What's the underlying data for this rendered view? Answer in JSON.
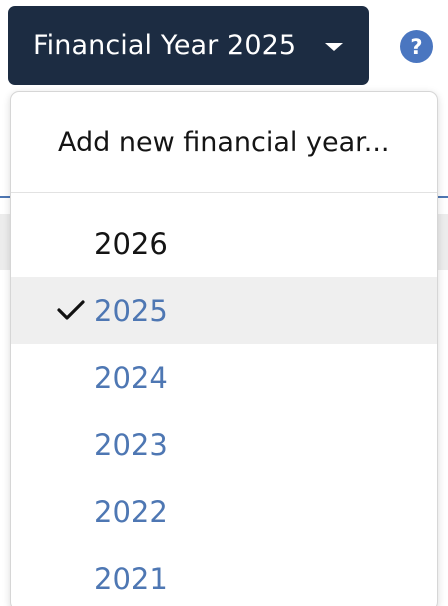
{
  "header": {
    "year_button_label": "Financial Year 2025",
    "help_icon_glyph": "?"
  },
  "dropdown": {
    "add_label": "Add new financial year...",
    "years": [
      {
        "label": "2026",
        "selected": false,
        "style": "plain"
      },
      {
        "label": "2025",
        "selected": true,
        "style": "available"
      },
      {
        "label": "2024",
        "selected": false,
        "style": "available"
      },
      {
        "label": "2023",
        "selected": false,
        "style": "available"
      },
      {
        "label": "2022",
        "selected": false,
        "style": "available"
      },
      {
        "label": "2021",
        "selected": false,
        "style": "available"
      }
    ]
  },
  "icons": {
    "caret": "caret-down-icon",
    "help": "help-icon",
    "check": "check-icon"
  },
  "colors": {
    "button_bg": "#1c2c42",
    "link_blue": "#4e77b3",
    "help_blue": "#4a76c0",
    "selected_bg": "#efefef"
  }
}
